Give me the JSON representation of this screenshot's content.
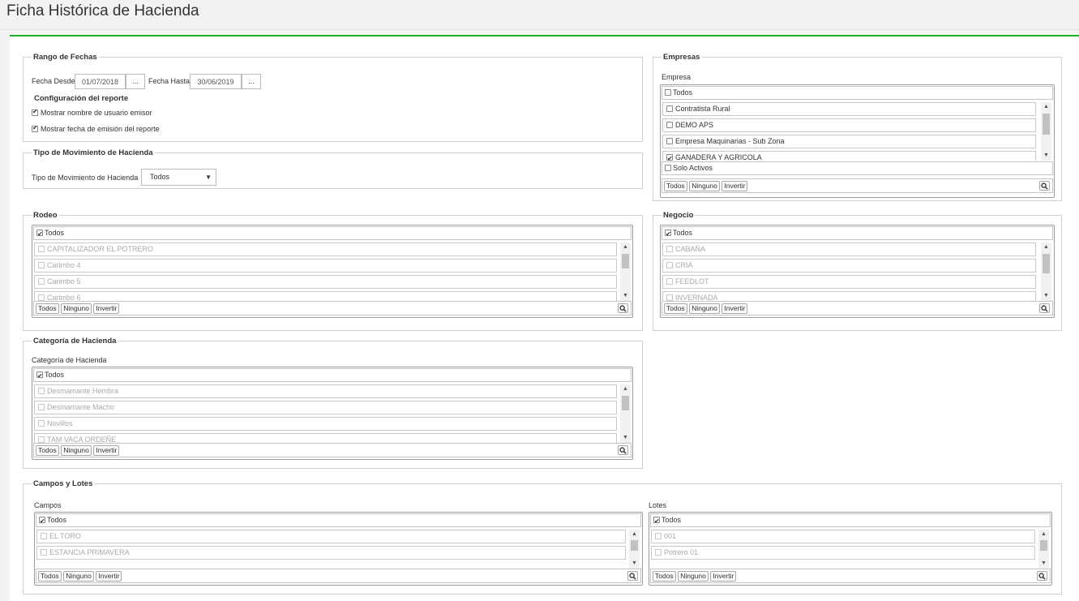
{
  "page": {
    "title": "Ficha Histórica de Hacienda"
  },
  "colors": {
    "accent": "#1ab02a"
  },
  "rango": {
    "legend": "Rango de Fechas",
    "desde_label": "Fecha Desde",
    "desde_value": "01/07/2018",
    "hasta_label": "Fecha Hasta",
    "hasta_value": "30/06/2019",
    "picker_label": "...",
    "config_title": "Configuración del reporte",
    "opt_usuario": "Mostrar nombre de usuario emisor",
    "opt_fecha": "Mostrar fecha de emisión del reporte"
  },
  "tipo": {
    "legend": "Tipo de Movimiento de Hacienda",
    "label": "Tipo de Movimiento de Hacienda",
    "selected": "Todos"
  },
  "empresas": {
    "legend": "Empresas",
    "label": "Empresa",
    "all_label": "Todos",
    "items": [
      "Contratista Rural",
      "DEMO APS",
      "Empresa Maquinarias - Sub Zona",
      "GANADERA Y AGRICOLA"
    ],
    "solo_activos": "Solo Activos"
  },
  "rodeo": {
    "legend": "Rodeo",
    "all_label": "Todos",
    "items": [
      "CAPITALIZADOR EL POTRERO",
      "Carimbo 4",
      "Carimbo 5",
      "Carimbo 6"
    ]
  },
  "negocio": {
    "legend": "Negocio",
    "all_label": "Todos",
    "items": [
      "CABAÑA",
      "CRIA",
      "FEEDLOT",
      "INVERNADA"
    ]
  },
  "categoria": {
    "legend": "Categoría de Hacienda",
    "label": "Categoría de Hacienda",
    "all_label": "Todos",
    "items": [
      "Desmamante Hembra",
      "Desmamante Macho",
      "Novillos",
      "TAM VACA ORDEÑE"
    ]
  },
  "campos_lotes": {
    "legend": "Campos y Lotes",
    "campos_label": "Campos",
    "lotes_label": "Lotes",
    "campos_all": "Todos",
    "lotes_all": "Todos",
    "campos_items": [
      "EL TORO",
      "ESTANCIA PRIMAVERA"
    ],
    "lotes_items": [
      "001",
      "Potrero 01"
    ]
  },
  "footer_buttons": {
    "all": "Todos",
    "none": "Ninguno",
    "invert": "Invertir"
  }
}
